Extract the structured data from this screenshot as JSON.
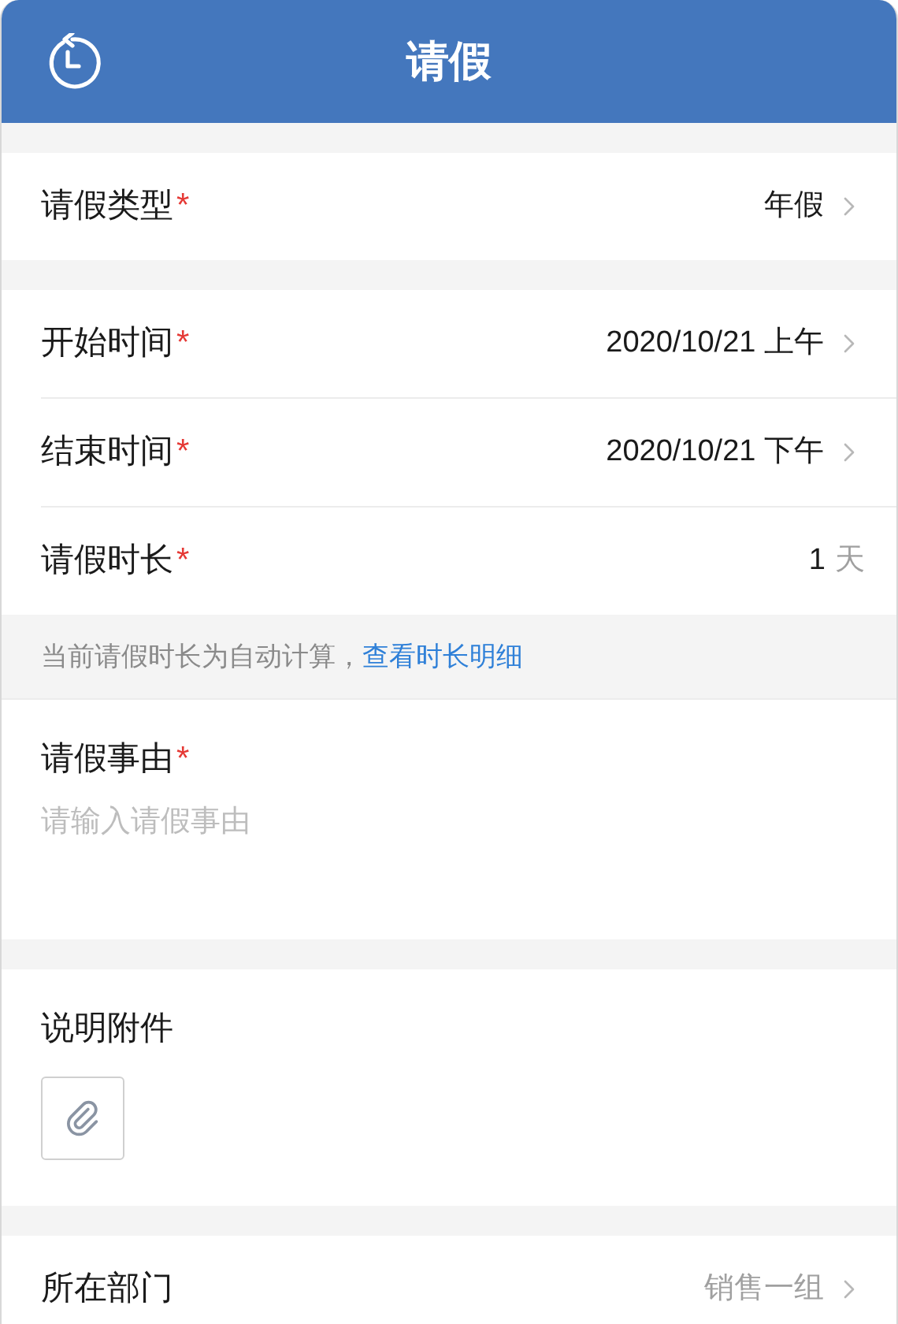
{
  "header": {
    "title": "请假"
  },
  "required_mark": "*",
  "sections": [
    {
      "kind": "rows",
      "rows": [
        {
          "label": "请假类型",
          "required": true,
          "value": "年假",
          "chevron": true,
          "disabled": false
        }
      ]
    },
    {
      "kind": "rows",
      "rows": [
        {
          "label": "开始时间",
          "required": true,
          "value": "2020/10/21 上午",
          "chevron": true,
          "disabled": false
        },
        {
          "label": "结束时间",
          "required": true,
          "value": "2020/10/21 下午",
          "chevron": true,
          "disabled": false
        },
        {
          "label": "请假时长",
          "required": true,
          "value": "1",
          "unit": "天",
          "chevron": false,
          "disabled": false
        }
      ],
      "note": {
        "text": "当前请假时长为自动计算，",
        "link": "查看时长明细"
      }
    },
    {
      "kind": "textarea",
      "label": "请假事由",
      "required": true,
      "placeholder": "请输入请假事由"
    },
    {
      "kind": "attachment",
      "label": "说明附件",
      "required": false
    },
    {
      "kind": "rows",
      "rows": [
        {
          "label": "所在部门",
          "required": false,
          "value": "销售一组",
          "chevron": true,
          "disabled": true
        }
      ]
    }
  ]
}
